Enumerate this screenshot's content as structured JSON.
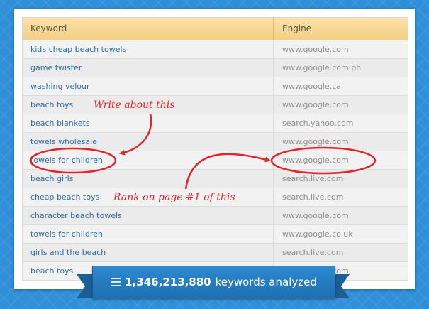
{
  "table": {
    "headers": {
      "keyword": "Keyword",
      "engine": "Engine"
    },
    "rows": [
      {
        "keyword": "kids cheap beach towels",
        "engine": "www.google.com"
      },
      {
        "keyword": "game twister",
        "engine": "www.google.com.ph"
      },
      {
        "keyword": "washing velour",
        "engine": "www.google.ca"
      },
      {
        "keyword": "beach toys",
        "engine": "www.google.com"
      },
      {
        "keyword": "beach blankets",
        "engine": "search.yahoo.com"
      },
      {
        "keyword": "towels wholesale",
        "engine": "www.google.com"
      },
      {
        "keyword": "towels for children",
        "engine": "www.google.com"
      },
      {
        "keyword": "beach girls",
        "engine": "search.live.com"
      },
      {
        "keyword": "cheap beach toys",
        "engine": "search.live.com"
      },
      {
        "keyword": "character beach towels",
        "engine": "www.google.com"
      },
      {
        "keyword": "towels for children",
        "engine": "www.google.co.uk"
      },
      {
        "keyword": "girls and the beach",
        "engine": "search.live.com"
      },
      {
        "keyword": "beach toys",
        "engine": "www.google.com"
      }
    ]
  },
  "annotations": {
    "write_about": "Write about this",
    "rank_on_page": "Rank on page #1 of this",
    "color": "#e0262b"
  },
  "banner": {
    "count": "1,346,213,880",
    "label": "keywords analyzed",
    "icon": "list-icon"
  },
  "colors": {
    "background": "#2f8fd8",
    "header": "#f3cf84",
    "link": "#2c6ea6",
    "banner": "#2278bd"
  }
}
